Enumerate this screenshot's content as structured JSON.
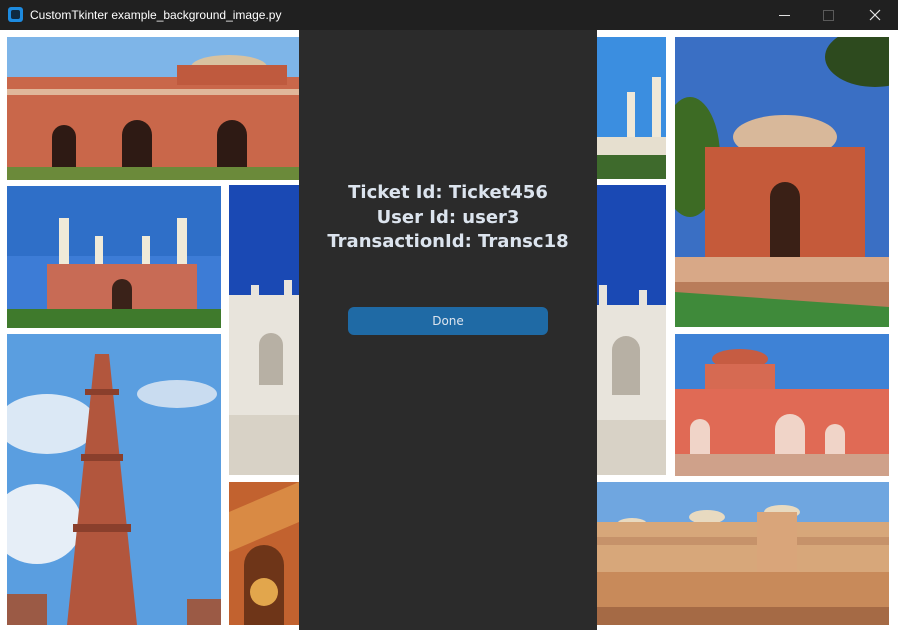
{
  "window": {
    "title": "CustomTkinter example_background_image.py",
    "controls": {
      "minimize": "minimize",
      "maximize": "maximize",
      "close": "close"
    }
  },
  "panel": {
    "ticket_line": "Ticket Id: Ticket456",
    "user_line": "User Id: user3",
    "transaction_line": "TransactionId: Transc18",
    "done_button": "Done"
  },
  "colors": {
    "panel_background": "#2b2b2b",
    "button": "#1f6aa5",
    "text": "#dce4ee",
    "titlebar": "#202020"
  },
  "background_tiles": [
    "red-fort-photo",
    "akbar-tomb-photo",
    "qutub-minar-photo",
    "taj-mahal-left-photo",
    "fatehpur-detail-photo",
    "taj-mahal-minarets-photo",
    "taj-mahal-right-photo",
    "humayun-tomb-photo",
    "red-pavilion-photo",
    "amber-fort-photo"
  ]
}
